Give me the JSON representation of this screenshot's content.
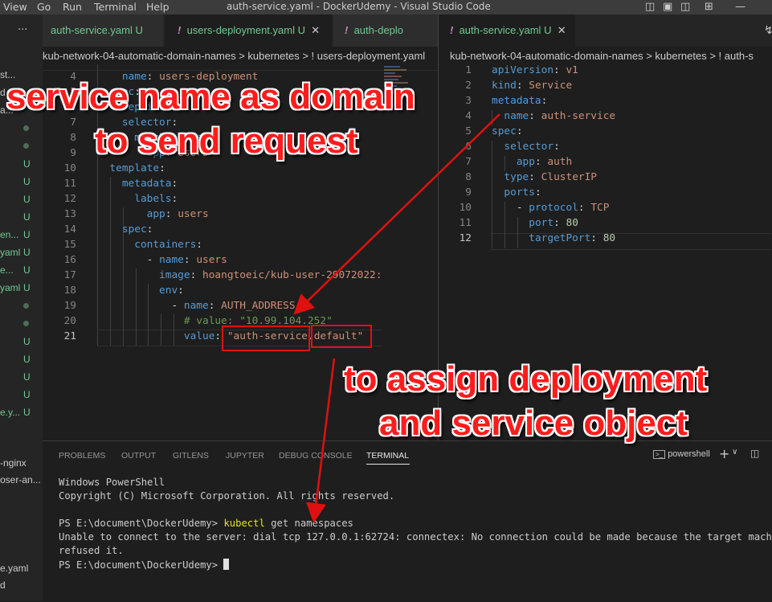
{
  "menu": [
    "View",
    "Go",
    "Run",
    "Terminal",
    "Help"
  ],
  "window_title": "auth-service.yaml - DockerUdemy - Visual Studio Code",
  "sidebar": {
    "rows": [
      {
        "name": "st...",
        "status": ""
      },
      {
        "name": "d",
        "status": ""
      },
      {
        "name": "a...",
        "status": ""
      },
      {
        "name": "",
        "status": "dot"
      },
      {
        "name": "",
        "status": "dot"
      },
      {
        "name": "",
        "status": "U"
      },
      {
        "name": "",
        "status": "U"
      },
      {
        "name": "",
        "status": "U"
      },
      {
        "name": "",
        "status": "U"
      },
      {
        "name": "en...",
        "status": "U"
      },
      {
        "name": "yaml",
        "status": "U"
      },
      {
        "name": "e...",
        "status": "U"
      },
      {
        "name": "yaml",
        "status": "U"
      },
      {
        "name": "",
        "status": "dot"
      },
      {
        "name": "",
        "status": "dot"
      },
      {
        "name": "",
        "status": "U"
      },
      {
        "name": "",
        "status": "U"
      },
      {
        "name": "",
        "status": "U"
      },
      {
        "name": "",
        "status": "U"
      },
      {
        "name": "e.y...",
        "status": "U"
      }
    ],
    "bottom_items": [
      "-nginx",
      "oser-an...",
      "e.yaml",
      "d"
    ]
  },
  "left_editor": {
    "tabs": [
      {
        "label": "auth-service.yaml",
        "badge": "U"
      },
      {
        "label": "users-deployment.yaml",
        "badge": "U"
      },
      {
        "label": "auth-deplo",
        "badge": ""
      }
    ],
    "breadcrumb": "kub-network-04-automatic-domain-names > kubernetes > ! users-deployment.yaml",
    "lines": [
      {
        "num": "4",
        "html": "    <span class='k'>name</span><span class='p'>: </span><span class='s'>users-deployment</span>"
      },
      {
        "num": "5",
        "html": "  <span class='k'>spec</span><span class='p'>:</span>"
      },
      {
        "num": "6",
        "html": "    <span class='k'>replicas</span><span class='p'>: </span><span class='n'>1</span>"
      },
      {
        "num": "7",
        "html": "    <span class='k'>selector</span><span class='p'>:</span>"
      },
      {
        "num": "8",
        "html": "      <span class='k'>matchLabels</span><span class='p'>:</span>"
      },
      {
        "num": "9",
        "html": "        <span class='k'>app</span><span class='p'>: </span><span class='s'>users</span>"
      },
      {
        "num": "10",
        "html": "  <span class='k'>template</span><span class='p'>:</span>"
      },
      {
        "num": "11",
        "html": "    <span class='k'>metadata</span><span class='p'>:</span>"
      },
      {
        "num": "12",
        "html": "      <span class='k'>labels</span><span class='p'>:</span>"
      },
      {
        "num": "13",
        "html": "        <span class='k'>app</span><span class='p'>: </span><span class='s'>users</span>"
      },
      {
        "num": "14",
        "html": "    <span class='k'>spec</span><span class='p'>:</span>"
      },
      {
        "num": "15",
        "html": "      <span class='k'>containers</span><span class='p'>:</span>"
      },
      {
        "num": "16",
        "html": "        <span class='p'>- </span><span class='k'>name</span><span class='p'>: </span><span class='s'>users</span>"
      },
      {
        "num": "17",
        "html": "          <span class='k'>image</span><span class='p'>: </span><span class='s'>hoangtoeic/kub-user-29072022:</span>"
      },
      {
        "num": "18",
        "html": "          <span class='k'>env</span><span class='p'>:</span>"
      },
      {
        "num": "19",
        "html": "            <span class='p'>- </span><span class='k'>name</span><span class='p'>: </span><span class='s'>AUTH_ADDRESS</span>"
      },
      {
        "num": "20",
        "html": "              <span class='c'># value: \"10.99.104.252\"</span>"
      },
      {
        "num": "21",
        "html": "              <span class='k'>value</span><span class='p'>: </span><span class='s'>\"auth-service.default\"</span>"
      }
    ],
    "active_line": "21"
  },
  "right_editor": {
    "tab": {
      "label": "auth-service.yaml",
      "badge": "U"
    },
    "breadcrumb": "kub-network-04-automatic-domain-names > kubernetes > ! auth-s",
    "lines": [
      {
        "num": "1",
        "html": "<span class='k'>apiVersion</span><span class='p'>: </span><span class='s'>v1</span>"
      },
      {
        "num": "2",
        "html": "<span class='k'>kind</span><span class='p'>: </span><span class='s'>Service</span>"
      },
      {
        "num": "3",
        "html": "<span class='k'>metadata</span><span class='p'>:</span>"
      },
      {
        "num": "4",
        "html": "  <span class='k'>name</span><span class='p'>: </span><span class='s'>auth-service</span>"
      },
      {
        "num": "5",
        "html": "<span class='k'>spec</span><span class='p'>:</span>"
      },
      {
        "num": "6",
        "html": "  <span class='k'>selector</span><span class='p'>:</span>"
      },
      {
        "num": "7",
        "html": "    <span class='k'>app</span><span class='p'>: </span><span class='s'>auth</span>"
      },
      {
        "num": "8",
        "html": "  <span class='k'>type</span><span class='p'>: </span><span class='s'>ClusterIP</span>"
      },
      {
        "num": "9",
        "html": "  <span class='k'>ports</span><span class='p'>:</span>"
      },
      {
        "num": "10",
        "html": "    <span class='p'>- </span><span class='k'>protocol</span><span class='p'>: </span><span class='s'>TCP</span>"
      },
      {
        "num": "11",
        "html": "      <span class='k'>port</span><span class='p'>: </span><span class='n'>80</span>"
      },
      {
        "num": "12",
        "html": "      <span class='k'>targetPort</span><span class='p'>: </span><span class='n'>80</span>"
      }
    ],
    "active_line": "12"
  },
  "panel": {
    "tabs": [
      "PROBLEMS",
      "OUTPUT",
      "GITLENS",
      "JUPYTER",
      "DEBUG CONSOLE",
      "TERMINAL"
    ],
    "active_tab": "TERMINAL",
    "shell_label": "powershell",
    "terminal_lines": [
      "Windows PowerShell",
      "Copyright (C) Microsoft Corporation. All rights reserved.",
      "",
      "PS E:\\document\\DockerUdemy> ",
      "Unable to connect to the server: dial tcp 127.0.0.1:62724: connectex: No connection could be made because the target machine ac",
      "refused it.",
      "PS E:\\document\\DockerUdemy> "
    ],
    "command": "kubectl",
    "command_args": " get namespaces"
  },
  "annotations": {
    "top_line1": "service name as domain",
    "top_line2": "to send request",
    "bottom_line1": "to assign deployment",
    "bottom_line2": "and service object"
  },
  "colors": {
    "annotation": "#ff1c1c",
    "untracked": "#73c991",
    "yaml_key": "#569cd6",
    "yaml_string": "#ce9178"
  }
}
